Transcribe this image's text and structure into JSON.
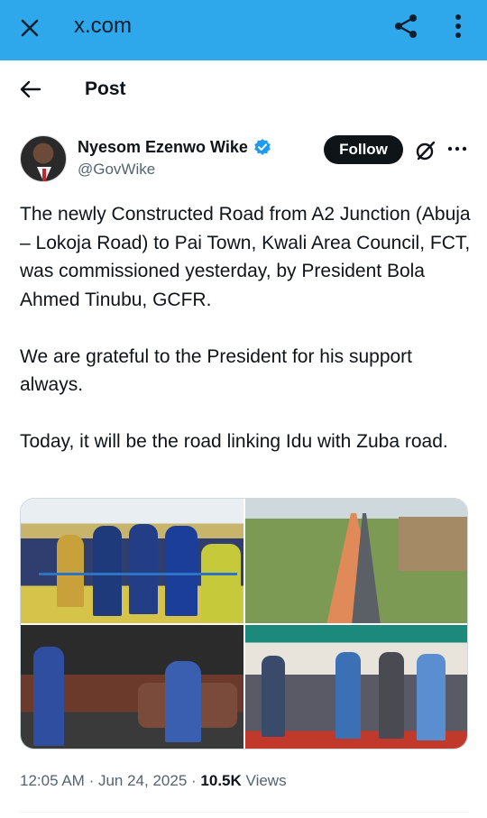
{
  "browser": {
    "url": "x.com",
    "accent_color": "#2ea8ea"
  },
  "header": {
    "title": "Post"
  },
  "author": {
    "display_name": "Nyesom Ezenwo Wike",
    "handle": "@GovWike",
    "verified": true,
    "verified_color": "#1d9bf0"
  },
  "actions": {
    "follow_label": "Follow"
  },
  "tweet": {
    "paragraphs": [
      "The newly Constructed Road from A2 Junction (Abuja – Lokoja Road) to Pai Town, Kwali Area Council,  FCT, was commissioned yesterday, by President Bola Ahmed Tinubu, GCFR.",
      "We are grateful to the President for his support always.",
      "Today,  it will be the road linking Idu with Zuba road."
    ]
  },
  "media": {
    "count": 4
  },
  "meta": {
    "time": "12:05 AM",
    "date": "Jun 24, 2025",
    "separator": "·",
    "views_count": "10.5K",
    "views_label": "Views"
  }
}
